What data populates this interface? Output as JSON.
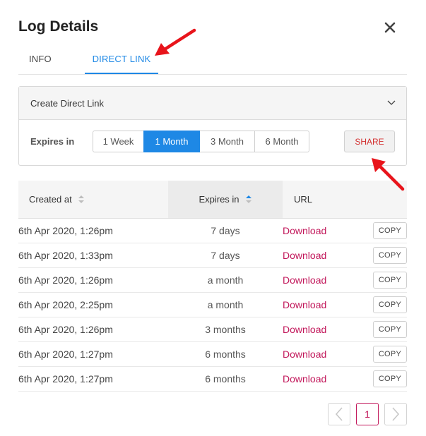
{
  "dialog": {
    "title": "Log Details"
  },
  "tabs": [
    {
      "label": "INFO",
      "active": false
    },
    {
      "label": "DIRECT LINK",
      "active": true
    }
  ],
  "panel": {
    "title": "Create Direct Link",
    "expires_label": "Expires in",
    "durations": [
      "1 Week",
      "1 Month",
      "3 Month",
      "6 Month"
    ],
    "selected_duration": "1 Month",
    "share_label": "SHARE"
  },
  "table": {
    "columns": {
      "created_at": "Created at",
      "expires_in": "Expires in",
      "url": "URL"
    },
    "sorted_column": "expires_in",
    "sort_direction": "ascending",
    "rows": [
      {
        "created_at": "6th Apr 2020, 1:26pm",
        "expires_in": "7 days",
        "url_label": "Download",
        "copy_label": "COPY"
      },
      {
        "created_at": "6th Apr 2020, 1:33pm",
        "expires_in": "7 days",
        "url_label": "Download",
        "copy_label": "COPY"
      },
      {
        "created_at": "6th Apr 2020, 1:26pm",
        "expires_in": "a month",
        "url_label": "Download",
        "copy_label": "COPY"
      },
      {
        "created_at": "6th Apr 2020, 2:25pm",
        "expires_in": "a month",
        "url_label": "Download",
        "copy_label": "COPY"
      },
      {
        "created_at": "6th Apr 2020, 1:26pm",
        "expires_in": "3 months",
        "url_label": "Download",
        "copy_label": "COPY"
      },
      {
        "created_at": "6th Apr 2020, 1:27pm",
        "expires_in": "6 months",
        "url_label": "Download",
        "copy_label": "COPY"
      },
      {
        "created_at": "6th Apr 2020, 1:27pm",
        "expires_in": "6 months",
        "url_label": "Download",
        "copy_label": "COPY"
      }
    ]
  },
  "pagination": {
    "current_page": "1"
  },
  "colors": {
    "accent_blue": "#1e88e5",
    "link_red": "#c2185b",
    "share_red": "#d32f2f",
    "annotation_arrow": "#e8141b"
  }
}
